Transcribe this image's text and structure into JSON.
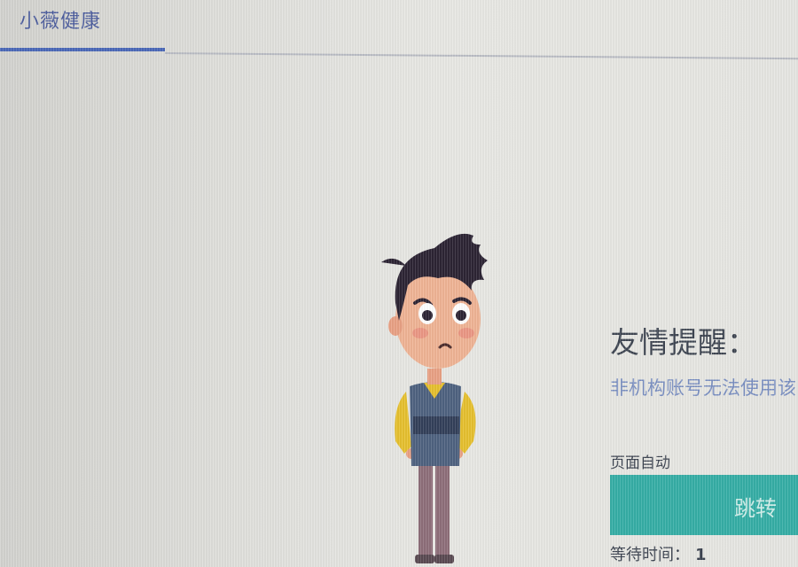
{
  "header": {
    "tab_label": "小薇健康"
  },
  "notice": {
    "title": "友情提醒：",
    "message": "非机构账号无法使用该",
    "auto_text": "页面自动",
    "button_label": "跳转",
    "wait_label": "等待时间：",
    "wait_value": "1"
  },
  "colors": {
    "accent": "#4a68b8",
    "button": "#36aea6"
  }
}
